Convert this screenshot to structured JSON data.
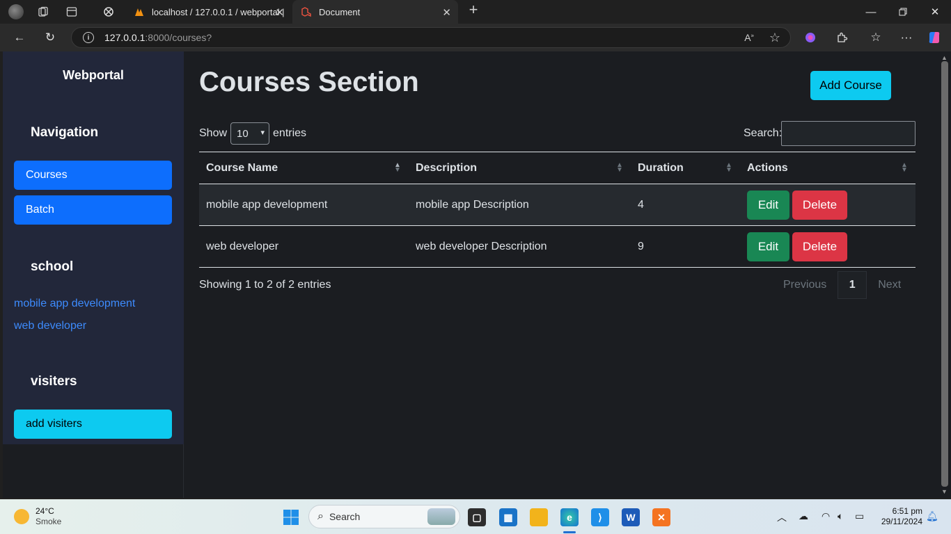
{
  "browser": {
    "tabs": [
      {
        "title": "localhost / 127.0.0.1 / webportal |"
      },
      {
        "title": "Document"
      }
    ],
    "url_host": "127.0.0.1",
    "url_path": ":8000/courses?"
  },
  "sidebar": {
    "brand": "Webportal",
    "sections": {
      "navigation": "Navigation",
      "school": "school",
      "visiters": "visiters"
    },
    "nav_items": [
      {
        "label": "Courses"
      },
      {
        "label": "Batch"
      }
    ],
    "school_links": [
      {
        "label": "mobile app development"
      },
      {
        "label": "web developer"
      }
    ],
    "visiters_button": "add visiters"
  },
  "main": {
    "title": "Courses Section",
    "add_button": "Add Course",
    "length": {
      "show": "Show",
      "value": "10",
      "entries": "entries"
    },
    "search_label": "Search:",
    "columns": [
      "Course Name",
      "Description",
      "Duration",
      "Actions"
    ],
    "rows": [
      {
        "name": "mobile app development",
        "description": "mobile app Description",
        "duration": "4",
        "edit": "Edit",
        "delete": "Delete"
      },
      {
        "name": "web developer",
        "description": "web developer Description",
        "duration": "9",
        "edit": "Edit",
        "delete": "Delete"
      }
    ],
    "info": "Showing 1 to 2 of 2 entries",
    "pager": {
      "previous": "Previous",
      "current": "1",
      "next": "Next"
    }
  },
  "taskbar": {
    "weather_temp": "24°C",
    "weather_desc": "Smoke",
    "search_placeholder": "Search",
    "time": "6:51 pm",
    "date": "29/11/2024"
  },
  "colors": {
    "primary": "#0d6efd",
    "info": "#0dcaf0",
    "success": "#198754",
    "danger": "#dc3545",
    "sidebar_bg": "#22273a",
    "page_bg": "#1b1d21"
  }
}
